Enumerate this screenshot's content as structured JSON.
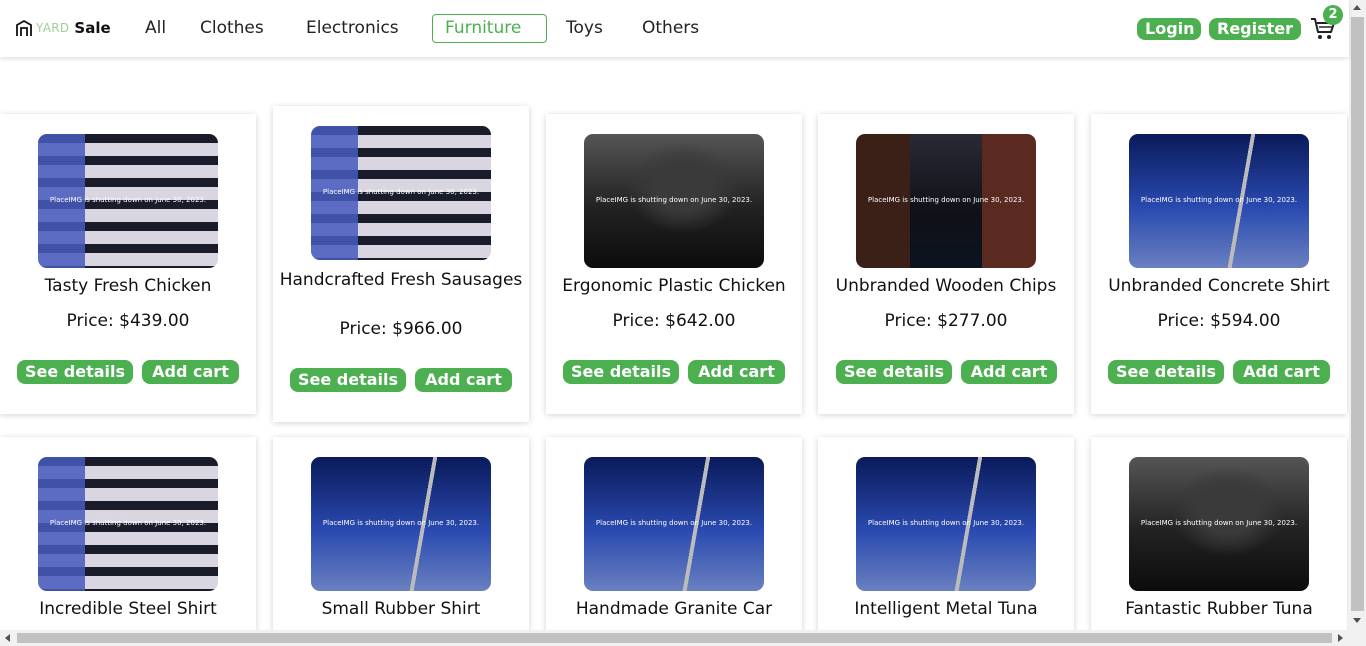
{
  "brand": {
    "yard": "YARD",
    "sale": "Sale"
  },
  "nav": {
    "categories": [
      "All",
      "Clothes",
      "Electronics",
      "Furniture",
      "Toys",
      "Others"
    ],
    "active_category": "Furniture",
    "login_label": "Login",
    "register_label": "Register",
    "cart_count": "2"
  },
  "products": [
    {
      "title": "Tasty Fresh Chicken",
      "price": "Price: $439.00",
      "image": "building",
      "caption": "PlaceIMG is shutting down on June 30, 2023."
    },
    {
      "title": "Handcrafted Fresh Sausages",
      "price": "Price: $966.00",
      "image": "building",
      "caption": "PlaceIMG is shutting down on June 30, 2023."
    },
    {
      "title": "Ergonomic Plastic Chicken",
      "price": "Price: $642.00",
      "image": "lamps",
      "caption": "PlaceIMG is shutting down on June 30, 2023."
    },
    {
      "title": "Unbranded Wooden Chips",
      "price": "Price: $277.00",
      "image": "street",
      "caption": "PlaceIMG is shutting down on June 30, 2023."
    },
    {
      "title": "Unbranded Concrete Shirt",
      "price": "Price: $594.00",
      "image": "bridge",
      "caption": "PlaceIMG is shutting down on June 30, 2023."
    },
    {
      "title": "Incredible Steel Shirt",
      "price": "",
      "image": "building",
      "caption": "PlaceIMG is shutting down on June 30, 2023."
    },
    {
      "title": "Small Rubber Shirt",
      "price": "",
      "image": "bridge",
      "caption": "PlaceIMG is shutting down on June 30, 2023."
    },
    {
      "title": "Handmade Granite Car",
      "price": "",
      "image": "bridge",
      "caption": "PlaceIMG is shutting down on June 30, 2023."
    },
    {
      "title": "Intelligent Metal Tuna",
      "price": "",
      "image": "bridge",
      "caption": "PlaceIMG is shutting down on June 30, 2023."
    },
    {
      "title": "Fantastic Rubber Tuna",
      "price": "",
      "image": "lamps",
      "caption": "PlaceIMG is shutting down on June 30, 2023."
    }
  ],
  "card_buttons": {
    "details_label": "See details",
    "add_label": "Add cart"
  },
  "colors": {
    "accent": "#4caf50",
    "text": "#111111"
  },
  "icons": {
    "logo": "house-icon",
    "cart": "cart-icon"
  }
}
